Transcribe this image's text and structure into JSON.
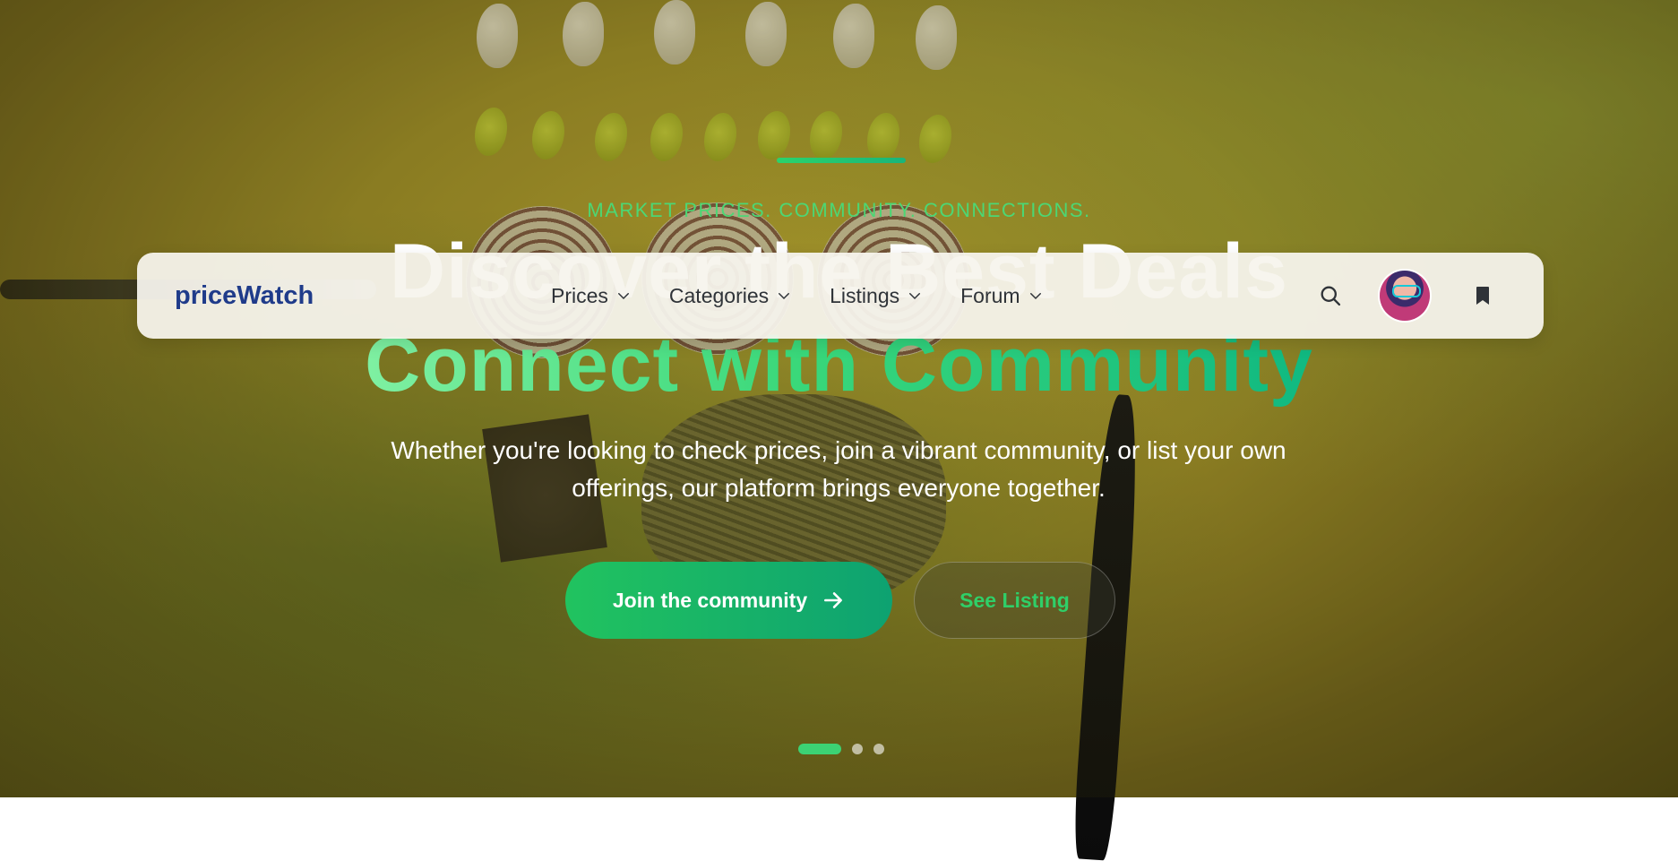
{
  "hero": {
    "tagline": "MARKET PRICES. COMMUNITY. CONNECTIONS.",
    "headline_line1": "Discover the Best Deals",
    "headline_line2": "Connect with Community",
    "subtitle": "Whether you're looking to check prices, join a vibrant community, or list your own offerings, our platform brings everyone together.",
    "primary_button": "Join the community",
    "secondary_button": "See Listing",
    "carousel": {
      "total_slides": 3,
      "active_slide": 1
    }
  },
  "navbar": {
    "logo": "priceWatch",
    "menu": [
      {
        "label": "Prices",
        "icon": "chevron-down-icon"
      },
      {
        "label": "Categories",
        "icon": "chevron-down-icon"
      },
      {
        "label": "Listings",
        "icon": "chevron-down-icon"
      },
      {
        "label": "Forum",
        "icon": "chevron-down-icon"
      }
    ],
    "actions": [
      "search-icon",
      "avatar",
      "bookmark-icon"
    ]
  },
  "colors": {
    "brand": "#1f3b8a",
    "accent_green": "#2bd36c",
    "accent_teal": "#10b981",
    "navbar_bg": "#f6f4ed"
  }
}
